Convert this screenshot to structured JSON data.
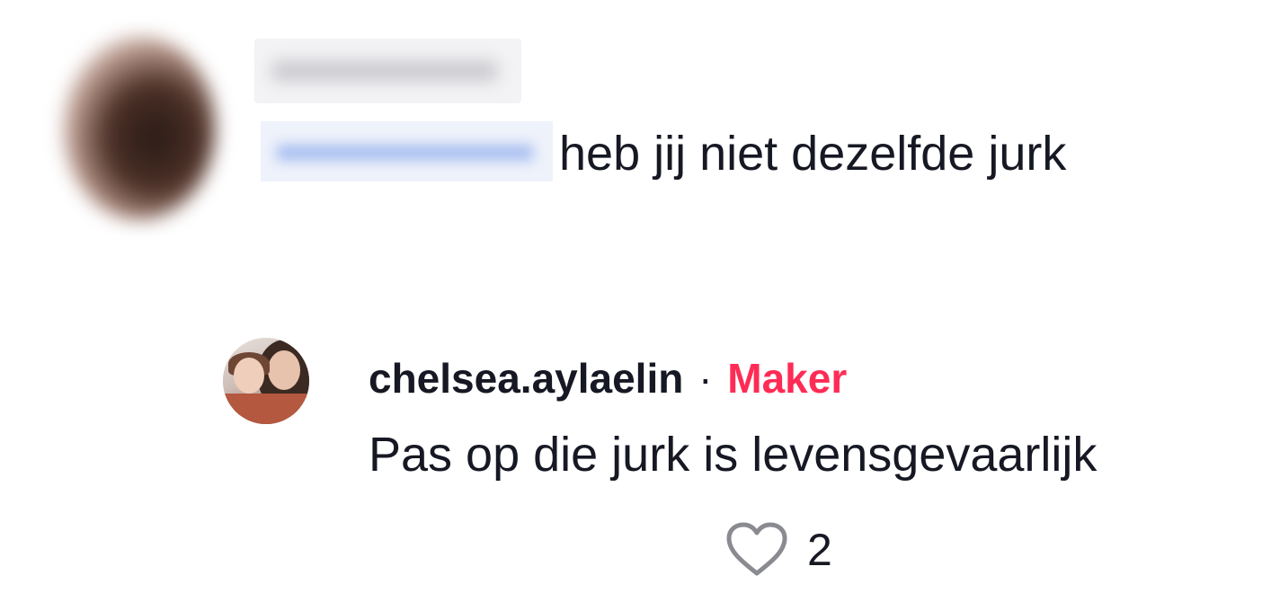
{
  "comment": {
    "avatar_icon": "user-avatar-blurred",
    "text": "heb jij niet dezelfde jurk"
  },
  "reply": {
    "avatar_icon": "user-avatar",
    "username": "chelsea.aylaelin",
    "separator": "·",
    "badge": "Maker",
    "text": "Pas op die jurk is levensgevaarlijk",
    "like_icon": "heart-outline-icon",
    "likes": "2"
  },
  "colors": {
    "text": "#161823",
    "maker_badge": "#fe2c55",
    "icon": "#8a8b91"
  }
}
